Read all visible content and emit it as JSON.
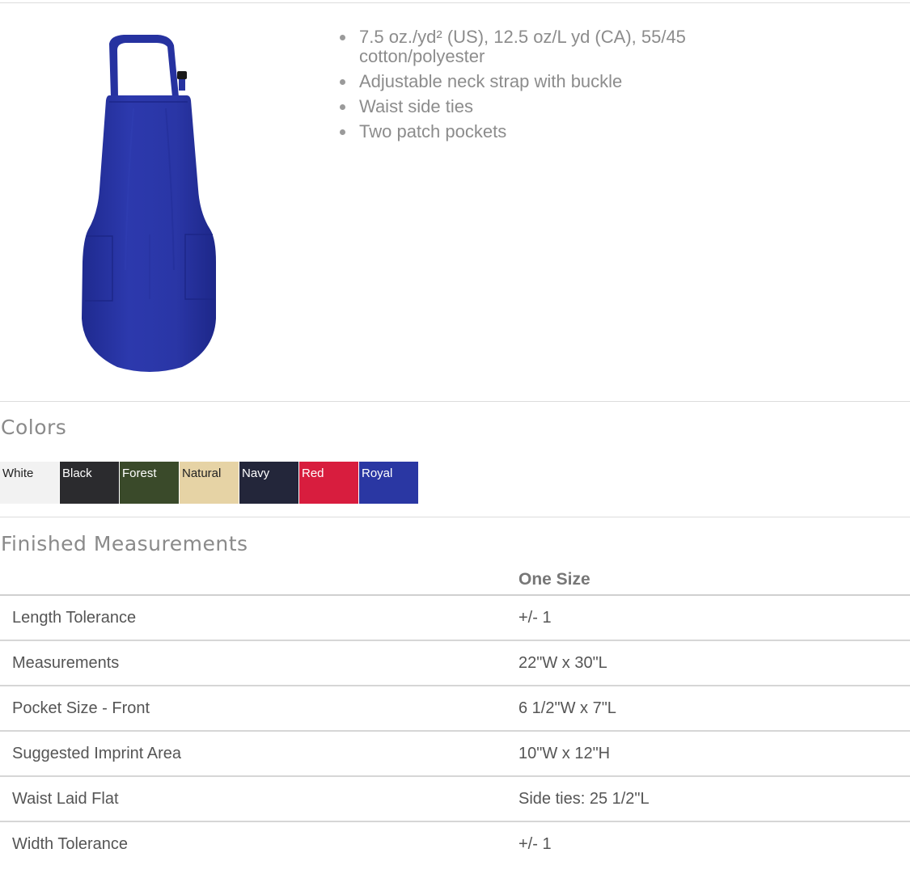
{
  "product": {
    "image_icon": "royal-apron-image",
    "image_color": "#2a35a8",
    "features": [
      "7.5 oz./yd² (US), 12.5 oz/L yd (CA), 55/45 cotton/polyester",
      "Adjustable neck strap with buckle",
      "Waist side ties",
      "Two patch pockets"
    ]
  },
  "colors": {
    "title": "Colors",
    "swatches": [
      {
        "label": "White",
        "color": "#f2f2f2",
        "text_color": "#222222"
      },
      {
        "label": "Black",
        "color": "#2b2b2e",
        "text_color": "#ffffff"
      },
      {
        "label": "Forest",
        "color": "#3a4a2a",
        "text_color": "#ffffff"
      },
      {
        "label": "Natural",
        "color": "#e6d3a5",
        "text_color": "#222222"
      },
      {
        "label": "Navy",
        "color": "#23263a",
        "text_color": "#ffffff"
      },
      {
        "label": "Red",
        "color": "#d81d3e",
        "text_color": "#ffffff"
      },
      {
        "label": "Royal",
        "color": "#2a37a3",
        "text_color": "#ffffff"
      }
    ]
  },
  "measurements": {
    "title": "Finished Measurements",
    "header": {
      "label_col": "",
      "size_col": "One Size"
    },
    "rows": [
      {
        "label": "Length Tolerance",
        "value": "+/- 1"
      },
      {
        "label": "Measurements",
        "value": "22\"W x 30\"L"
      },
      {
        "label": "Pocket Size - Front",
        "value": "6 1/2\"W x 7\"L"
      },
      {
        "label": "Suggested Imprint Area",
        "value": "10\"W x 12\"H"
      },
      {
        "label": "Waist Laid Flat",
        "value": "Side ties: 25 1/2\"L"
      },
      {
        "label": "Width Tolerance",
        "value": "+/- 1"
      }
    ]
  }
}
